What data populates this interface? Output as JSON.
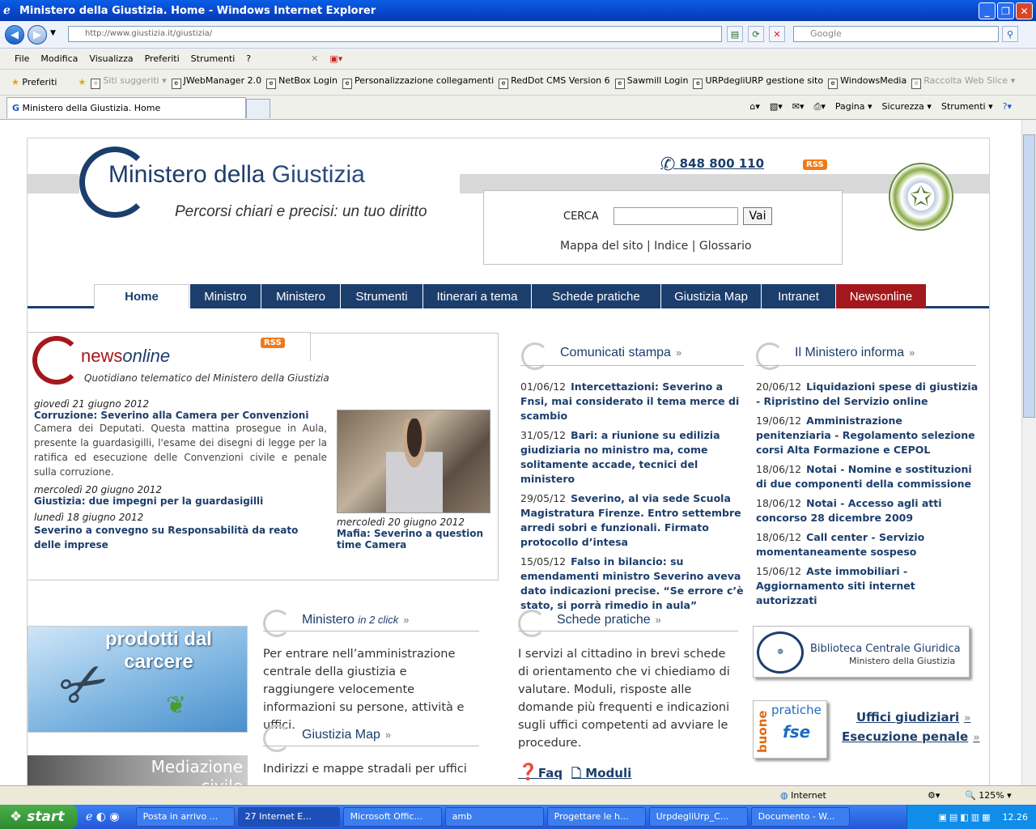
{
  "window": {
    "title": "Ministero della Giustizia. Home - Windows Internet Explorer"
  },
  "address": {
    "url": "http://www.giustizia.it/giustizia/",
    "search_placeholder": "Google"
  },
  "menu": [
    "File",
    "Modifica",
    "Visualizza",
    "Preferiti",
    "Strumenti",
    "?"
  ],
  "favorites": {
    "label": "Preferiti",
    "items": [
      "Siti suggeriti",
      "JWebManager 2.0",
      "NetBox Login",
      "Personalizzazione collegamenti",
      "RedDot CMS Version 6",
      "Sawmill Login",
      "URPdegliURP gestione sito",
      "WindowsMedia",
      "Raccolta Web Slice"
    ]
  },
  "tabs": {
    "active": "Ministero della Giustizia. Home"
  },
  "toolbar_right": [
    "Pagina",
    "Sicurezza",
    "Strumenti"
  ],
  "site": {
    "logo_title_a": "Ministero della ",
    "logo_title_b": "Giustizia",
    "tagline": "Percorsi chiari e precisi: un tuo diritto",
    "phone": "848 800 110",
    "rss": "RSS",
    "search": {
      "label": "CERCA",
      "button": "Vai",
      "links": [
        "Mappa del sito",
        "Indice",
        "Glossario"
      ]
    },
    "nav": [
      "Home",
      "Ministro",
      "Ministero",
      "Strumenti",
      "Itinerari a tema",
      "Schede pratiche",
      "Giustizia Map",
      "Intranet",
      "Newsonline"
    ],
    "news": {
      "brand_a": "news",
      "brand_b": "online",
      "subtitle": "Quotidiano telematico del Ministero della Giustizia",
      "items": [
        {
          "date": "giovedì 21 giugno 2012",
          "title": "Corruzione: Severino alla Camera per Convenzioni",
          "body": "Camera dei Deputati. Questa mattina prosegue in Aula, presente la guardasigilli, l'esame dei disegni di legge per la ratifica ed esecuzione delle Convenzioni civile e penale sulla corruzione."
        },
        {
          "date": "mercoledì 20 giugno 2012",
          "title": "Giustizia: due impegni per la guardasigilli"
        },
        {
          "date": "lunedì 18 giugno 2012",
          "title": "Severino a convegno su Responsabilità da reato delle imprese"
        }
      ],
      "photo_caption_date": "mercoledì 20 giugno 2012",
      "photo_caption_title": "Mafia: Severino a question time Camera"
    },
    "comunicati": {
      "title": "Comunicati stampa",
      "items": [
        {
          "date": "01/06/12",
          "text": "Intercettazioni: Severino a Fnsi, mai considerato il tema merce di scambio"
        },
        {
          "date": "31/05/12",
          "text": "Bari: a riunione su edilizia giudiziaria no ministro ma, come solitamente accade, tecnici del ministero"
        },
        {
          "date": "29/05/12",
          "text": "Severino, al via sede Scuola Magistratura Firenze. Entro settembre arredi sobri e funzionali. Firmato protocollo d’intesa"
        },
        {
          "date": "15/05/12",
          "text": "Falso in bilancio: su emendamenti ministro Severino aveva dato indicazioni precise. “Se errore c’è stato, si porrà rimedio in aula”"
        }
      ]
    },
    "informa": {
      "title": "Il Ministero informa",
      "items": [
        {
          "date": "20/06/12",
          "text": "Liquidazioni spese di giustizia - Ripristino del Servizio online"
        },
        {
          "date": "19/06/12",
          "text": "Amministrazione penitenziaria - Regolamento selezione corsi Alta Formazione e CEPOL"
        },
        {
          "date": "18/06/12",
          "text": "Notai - Nomine e sostituzioni di due componenti della commissione"
        },
        {
          "date": "18/06/12",
          "text": "Notai - Accesso agli atti concorso 28 dicembre 2009"
        },
        {
          "date": "18/06/12",
          "text": "Call center - Servizio momentaneamente sospeso"
        },
        {
          "date": "15/06/12",
          "text": "Aste immobiliari - Aggiornamento siti internet autorizzati"
        }
      ]
    },
    "ministero2click": {
      "title": "Ministero",
      "title_suffix": "in 2 click",
      "text": "Per entrare nell’amministrazione centrale della giustizia e raggiungere velocemente informazioni su persone, attività e uffici."
    },
    "giustiziamap": {
      "title": "Giustizia Map",
      "text": "Indirizzi e mappe stradali per uffici"
    },
    "schede": {
      "title": "Schede pratiche",
      "text": "I servizi al cittadino in brevi schede di orientamento che vi chiediamo di valutare. Moduli, risposte alle domande più frequenti e indicazioni sugli uffici competenti ad avviare le procedure."
    },
    "faq": "Faq",
    "moduli": "Moduli",
    "banners": {
      "carcere": "prodotti dal carcere",
      "mediazione": "Mediazione civile",
      "biblioteca_1": "Biblioteca Centrale Giuridica",
      "biblioteca_2": "Ministero della Giustizia",
      "buone": "buone",
      "pratiche": "pratiche",
      "fse": "fse"
    },
    "uffici": "Uffici giudiziari",
    "esecuzione": "Esecuzione penale"
  },
  "status": {
    "zone": "Internet",
    "zoom": "125%"
  },
  "taskbar": {
    "start": "start",
    "tasks": [
      "Posta in arrivo ...",
      "27 Internet E...",
      "Microsoft Offic...",
      "amb",
      "Progettare le h...",
      "UrpdegliUrp_C...",
      "Documento - W..."
    ],
    "clock": "12.26"
  }
}
